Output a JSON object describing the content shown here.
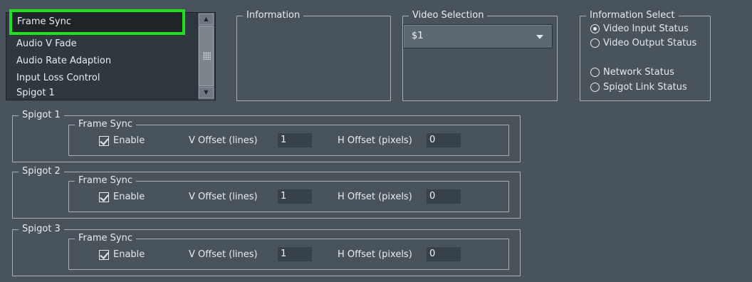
{
  "list": {
    "items": [
      "Frame Sync",
      "Audio V Fade",
      "Audio Rate Adaption",
      "Input Loss Control",
      "Spigot 1"
    ],
    "selected_index": 0
  },
  "information": {
    "title": "Information"
  },
  "video_selection": {
    "title": "Video Selection",
    "value": "$1"
  },
  "information_select": {
    "title": "Information Select",
    "options": [
      "Video Input Status",
      "Video Output Status",
      "Network Status",
      "Spigot Link Status"
    ],
    "selected_index": 0
  },
  "spigots": [
    {
      "title": "Spigot 1",
      "group_title": "Frame Sync",
      "enable_label": "Enable",
      "enabled": true,
      "v_offset_label": "V Offset (lines)",
      "v_offset": "1",
      "h_offset_label": "H Offset (pixels)",
      "h_offset": "0"
    },
    {
      "title": "Spigot 2",
      "group_title": "Frame Sync",
      "enable_label": "Enable",
      "enabled": true,
      "v_offset_label": "V Offset (lines)",
      "v_offset": "1",
      "h_offset_label": "H Offset (pixels)",
      "h_offset": "0"
    },
    {
      "title": "Spigot 3",
      "group_title": "Frame Sync",
      "enable_label": "Enable",
      "enabled": true,
      "v_offset_label": "V Offset (lines)",
      "v_offset": "1",
      "h_offset_label": "H Offset (pixels)",
      "h_offset": "0"
    }
  ],
  "colors": {
    "background": "#48535c",
    "selection_highlight": "#22e01e",
    "field_bg": "#37414a"
  },
  "icons": {
    "scroll_up": "chevron-up-icon",
    "scroll_down": "chevron-down-icon",
    "dropdown": "chevron-down-icon"
  }
}
